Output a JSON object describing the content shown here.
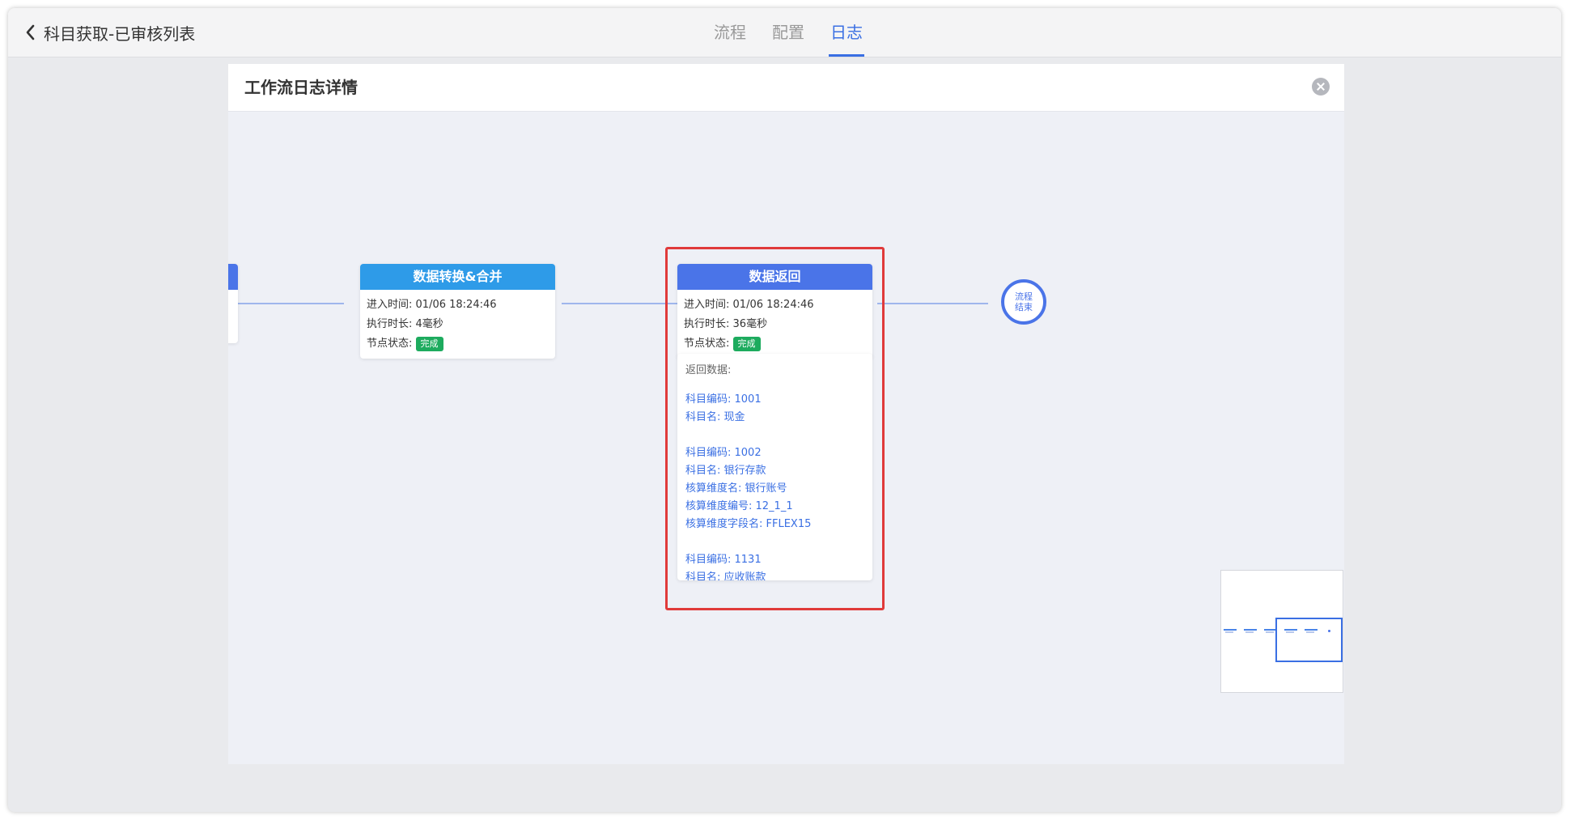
{
  "header": {
    "back_icon": "chevron-left-icon",
    "title": "科目获取-已审核列表",
    "tabs": [
      {
        "label": "流程",
        "active": false
      },
      {
        "label": "配置",
        "active": false
      },
      {
        "label": "日志",
        "active": true
      }
    ]
  },
  "dialog": {
    "title": "工作流日志详情",
    "close_icon": "close-circle-icon"
  },
  "flow": {
    "nodes": [
      {
        "title": "数据转换&合并",
        "header_color": "#2e9be8",
        "enter_label": "进入时间:",
        "enter_value": "01/06 18:24:46",
        "duration_label": "执行时长:",
        "duration_value": "4毫秒",
        "status_label": "节点状态:",
        "status_value": "完成"
      },
      {
        "title": "数据返回",
        "header_color": "#4a74e8",
        "enter_label": "进入时间:",
        "enter_value": "01/06 18:24:46",
        "duration_label": "执行时长:",
        "duration_value": "36毫秒",
        "status_label": "节点状态:",
        "status_value": "完成"
      }
    ],
    "return_data": {
      "heading": "返回数据:",
      "lines": [
        "科目编码: 1001",
        "科目名: 现金",
        "",
        "科目编码: 1002",
        "科目名: 银行存款",
        "核算维度名: 银行账号",
        "核算维度编号: 12_1_1",
        "核算维度字段名: FFLEX15",
        "",
        "科目编码: 1131",
        "科目名: 应收账款"
      ]
    },
    "end_node": {
      "line1": "流程",
      "line2": "结束"
    }
  },
  "colors": {
    "accent": "#3a6fe3",
    "status_done": "#1dab5e",
    "highlight_border": "#e03a3a"
  }
}
